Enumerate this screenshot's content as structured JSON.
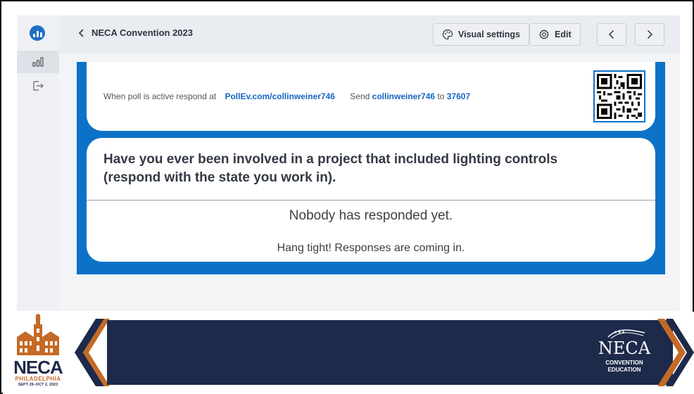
{
  "header": {
    "back_label": "NECA Convention 2023",
    "visual_settings_label": "Visual settings",
    "edit_label": "Edit"
  },
  "sidebar": {
    "items": [
      {
        "icon": "poll-bars-icon",
        "active": true
      },
      {
        "icon": "logout-icon",
        "active": false
      }
    ]
  },
  "poll": {
    "respond_prefix": "When poll is active respond at",
    "respond_url": "PollEv.com/collinweiner746",
    "send_prefix": "Send",
    "send_code": "collinweiner746",
    "send_to": "to",
    "send_number": "37607",
    "question": "Have you ever been involved in a project that included lighting controls (respond with the state you work in).",
    "empty_title": "Nobody has responded yet.",
    "empty_sub": "Hang tight! Responses are coming in."
  },
  "banner": {
    "left_logo": "NECA",
    "left_city": "PHILADELPHIA",
    "left_dates": "SEPT 29–OCT 2, 2023",
    "right_logo": "NECA",
    "right_sub_line1": "CONVENTION",
    "right_sub_line2": "EDUCATION"
  },
  "colors": {
    "accent": "#0c72c8",
    "link": "#1565c0",
    "navy": "#1e2a4a",
    "copper": "#c56a26"
  }
}
